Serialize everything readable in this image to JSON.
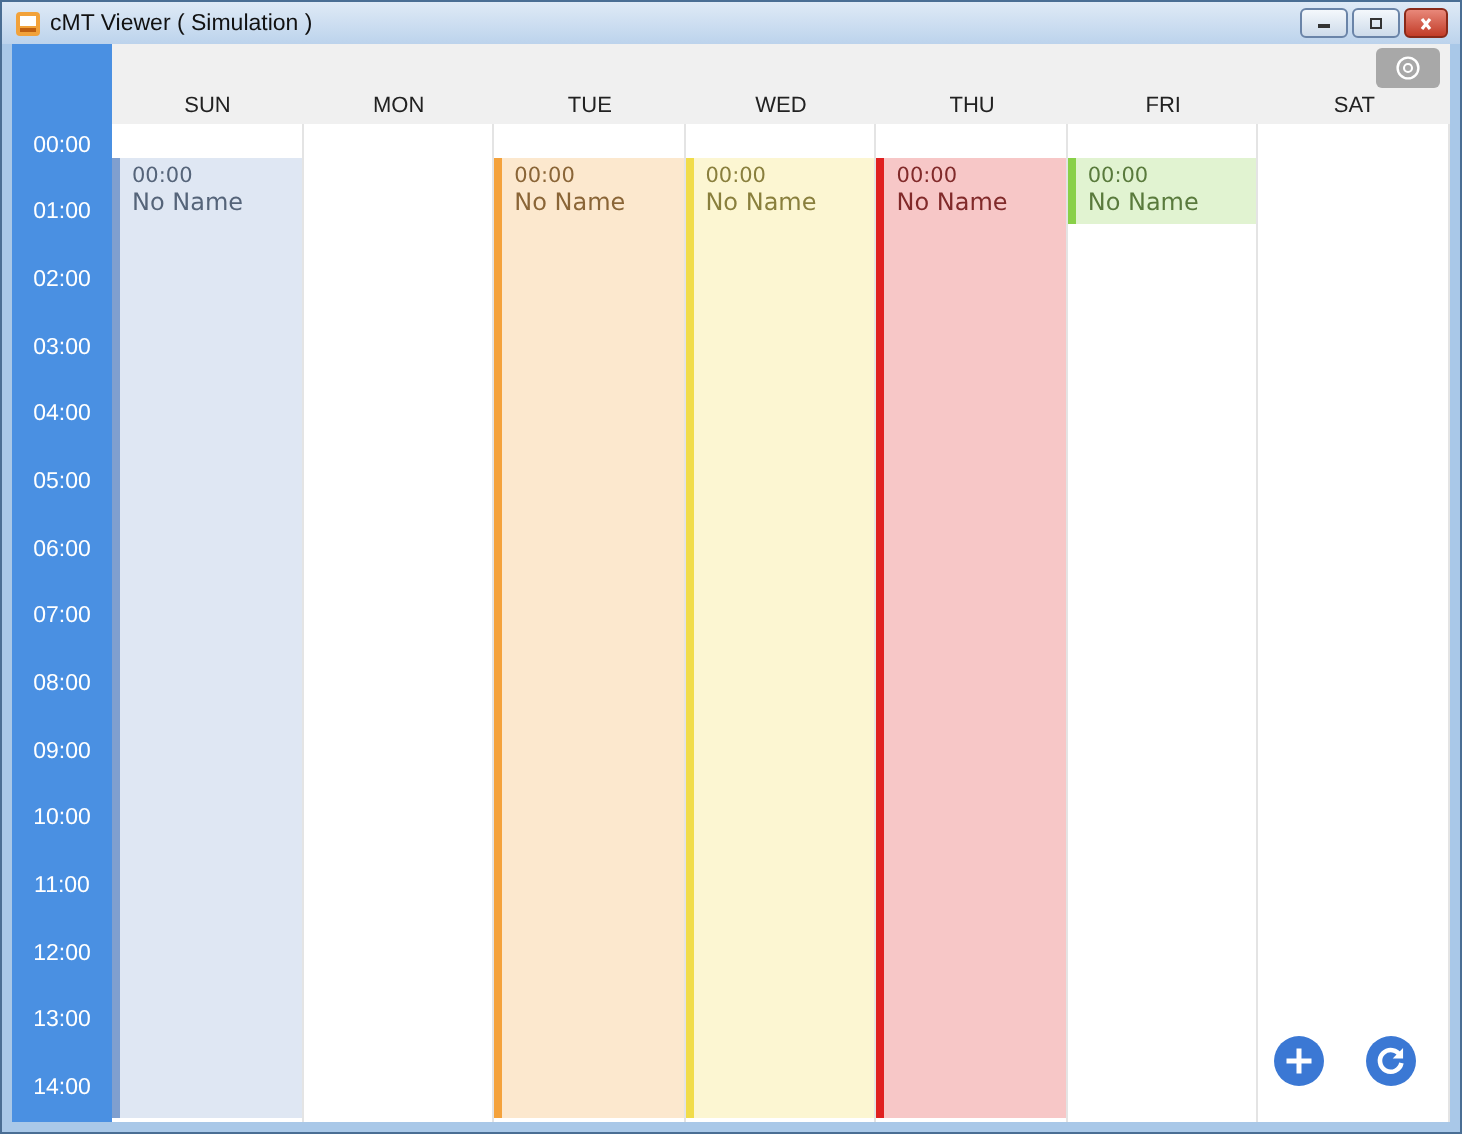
{
  "window": {
    "title": "cMT Viewer ( Simulation )"
  },
  "days": [
    {
      "label": "SUN",
      "events": [
        {
          "time": "00:00",
          "name": "No Name",
          "color": "#7f9fcf",
          "kind": "long"
        }
      ]
    },
    {
      "label": "MON"
    },
    {
      "label": "TUE",
      "events": [
        {
          "time": "00:00",
          "name": "No Name",
          "color": "#f4a23c",
          "kind": "long"
        }
      ]
    },
    {
      "label": "WED",
      "events": [
        {
          "time": "00:00",
          "name": "No Name",
          "color": "#f1dc4a",
          "kind": "long"
        }
      ]
    },
    {
      "label": "THU",
      "events": [
        {
          "time": "00:00",
          "name": "No Name",
          "color": "#e02020",
          "kind": "long"
        }
      ]
    },
    {
      "label": "FRI",
      "events": [
        {
          "time": "00:00",
          "name": "No Name",
          "color": "#88d048",
          "kind": "short"
        }
      ]
    },
    {
      "label": "SAT"
    }
  ],
  "hours": [
    "00:00",
    "01:00",
    "02:00",
    "03:00",
    "04:00",
    "05:00",
    "06:00",
    "07:00",
    "08:00",
    "09:00",
    "10:00",
    "11:00",
    "12:00",
    "13:00",
    "14:00"
  ]
}
